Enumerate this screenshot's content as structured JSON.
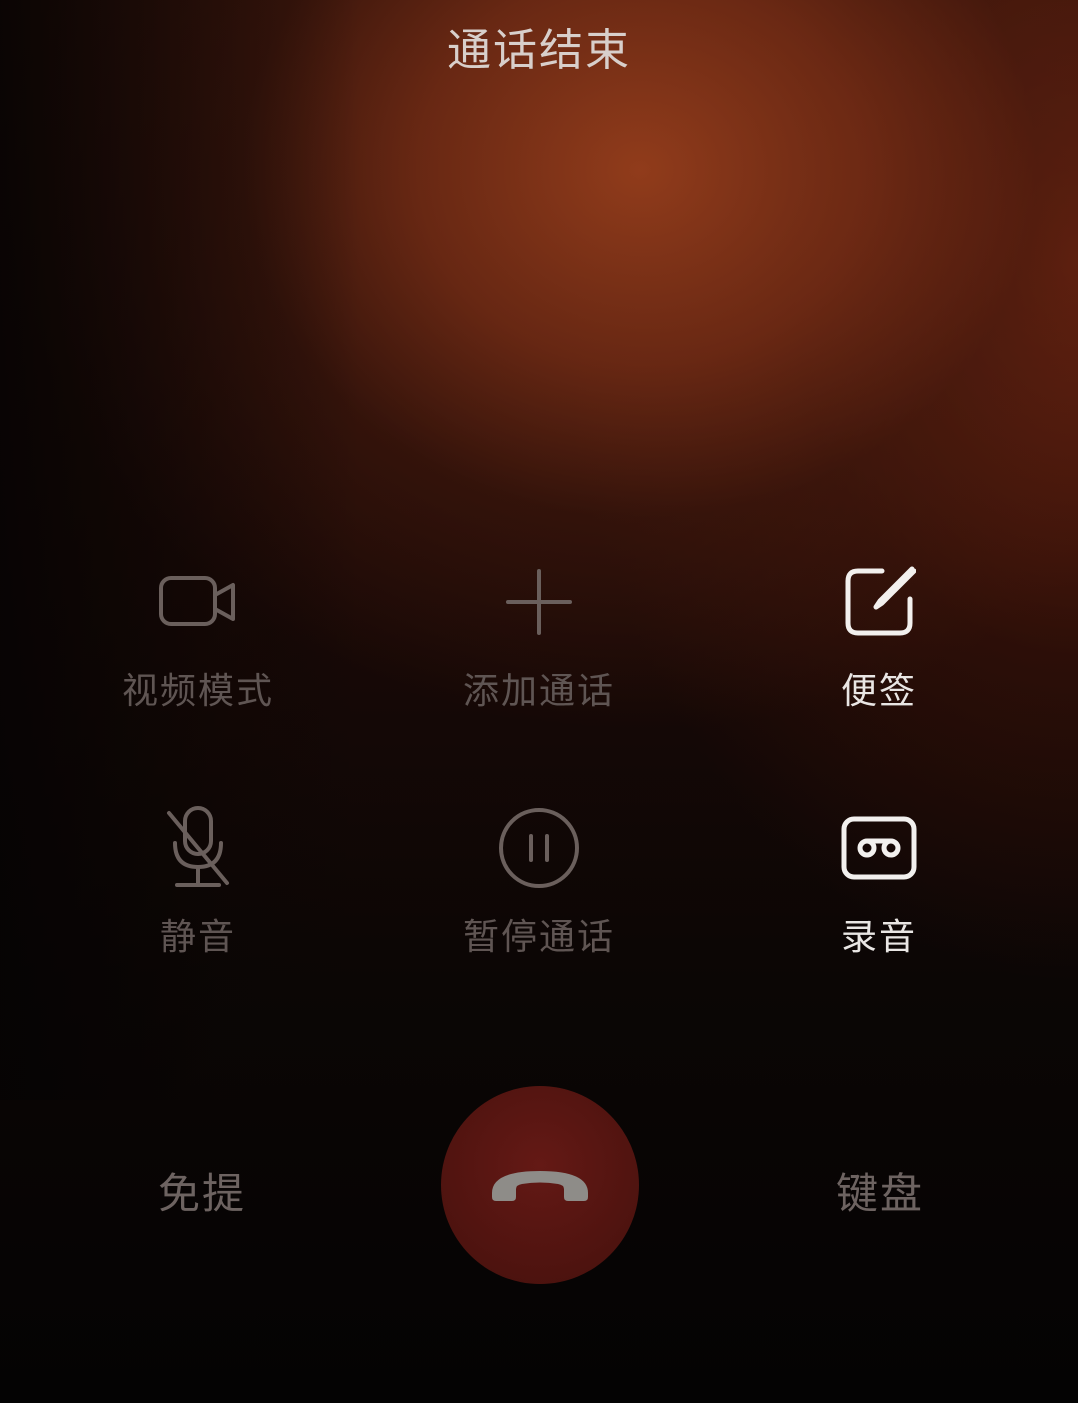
{
  "header": {
    "status": "通话结束"
  },
  "controls": [
    {
      "label": "视频模式",
      "icon": "video-camera-icon",
      "enabled": false
    },
    {
      "label": "添加通话",
      "icon": "plus-icon",
      "enabled": false
    },
    {
      "label": "便签",
      "icon": "note-edit-icon",
      "enabled": true
    },
    {
      "label": "静音",
      "icon": "microphone-muted-icon",
      "enabled": false
    },
    {
      "label": "暂停通话",
      "icon": "pause-icon",
      "enabled": false
    },
    {
      "label": "录音",
      "icon": "cassette-record-icon",
      "enabled": true
    }
  ],
  "bottom": {
    "speaker_label": "免提",
    "keypad_label": "键盘",
    "end_call_icon": "hang-up-phone-icon"
  },
  "colors": {
    "background_accent": "#963e1c",
    "end_call_button": "#4e130f",
    "enabled_text": "#e9e6e4",
    "disabled_text": "#5f5553"
  }
}
